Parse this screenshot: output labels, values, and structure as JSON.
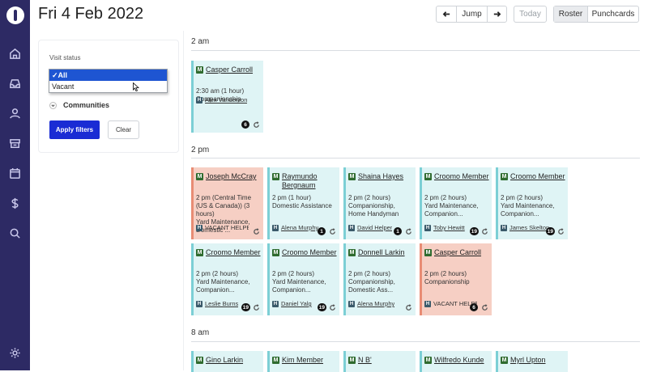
{
  "header": {
    "date_title": "Fri 4 Feb 2022",
    "jump_label": "Jump",
    "today_label": "Today",
    "roster_label": "Roster",
    "punchcards_label": "Punchcards"
  },
  "filters": {
    "visit_status_label": "Visit status",
    "options": [
      {
        "label": "✓All",
        "selected": true
      },
      {
        "label": "Vacant",
        "selected": false
      }
    ],
    "communities_label": "Communities",
    "apply_label": "Apply filters",
    "clear_label": "Clear"
  },
  "sections": [
    {
      "time": "2 am",
      "cards": [
        {
          "badge": "M",
          "name": "Casper Carroll",
          "time": "2:30 am (1 hour)",
          "service": "Companionship",
          "helper_badge": "H",
          "helper": "Alex Vanderzon",
          "count": "6",
          "vacant": false
        }
      ]
    },
    {
      "time": "2 pm",
      "cards": [
        {
          "badge": "M",
          "name": "Joseph McCray",
          "time": "2 pm (Central Time (US & Canada)) (3 hours)",
          "service": "Yard Maintenance, Domestic ...",
          "helper_badge": "H",
          "helper": "VACANT HELPER",
          "count": "",
          "vacant": true
        },
        {
          "badge": "M",
          "name": "Raymundo Bergnaum",
          "time": "2 pm (1 hour)",
          "service": "Domestic Assistance",
          "helper_badge": "H",
          "helper": "Alena Murphy",
          "count": "1",
          "vacant": false
        },
        {
          "badge": "M",
          "name": "Shaina Hayes",
          "time": "2 pm (2 hours)",
          "service": "Companionship, Home Handyman",
          "helper_badge": "H",
          "helper": "David Helper",
          "count": "1",
          "vacant": false
        },
        {
          "badge": "M",
          "name": "Croomo Member",
          "time": "2 pm (2 hours)",
          "service": "Yard Maintenance, Companion...",
          "helper_badge": "H",
          "helper": "Toby Hewitt",
          "count": "19",
          "vacant": false
        },
        {
          "badge": "M",
          "name": "Croomo Member",
          "time": "2 pm (2 hours)",
          "service": "Yard Maintenance, Companion...",
          "helper_badge": "H",
          "helper": "James Skelton",
          "count": "19",
          "vacant": false
        },
        {
          "badge": "M",
          "name": "Croomo Member",
          "time": "2 pm (2 hours)",
          "service": "Yard Maintenance, Companion...",
          "helper_badge": "H",
          "helper": "Leslie Burns",
          "count": "19",
          "vacant": false
        },
        {
          "badge": "M",
          "name": "Croomo Member",
          "time": "2 pm (2 hours)",
          "service": "Yard Maintenance, Companion...",
          "helper_badge": "H",
          "helper": "Daniel Yalg",
          "count": "19",
          "vacant": false
        },
        {
          "badge": "M",
          "name": "Donnell Larkin",
          "time": "2 pm (2 hours)",
          "service": "Companionship, Domestic Ass...",
          "helper_badge": "H",
          "helper": "Alena Murphy",
          "count": "",
          "vacant": false
        },
        {
          "badge": "M",
          "name": "Casper Carroll",
          "time": "2 pm (2 hours)",
          "service": "Companionship",
          "helper_badge": "H",
          "helper": "VACANT HELPER",
          "count": "6",
          "vacant": true
        }
      ]
    },
    {
      "time": "8 am",
      "cards": [
        {
          "badge": "M",
          "name": "Gino Larkin"
        },
        {
          "badge": "M",
          "name": "Kim Member"
        },
        {
          "badge": "M",
          "name": "N B'"
        },
        {
          "badge": "M",
          "name": "Wilfredo Kunde"
        },
        {
          "badge": "M",
          "name": "Myrl Upton"
        }
      ]
    }
  ]
}
